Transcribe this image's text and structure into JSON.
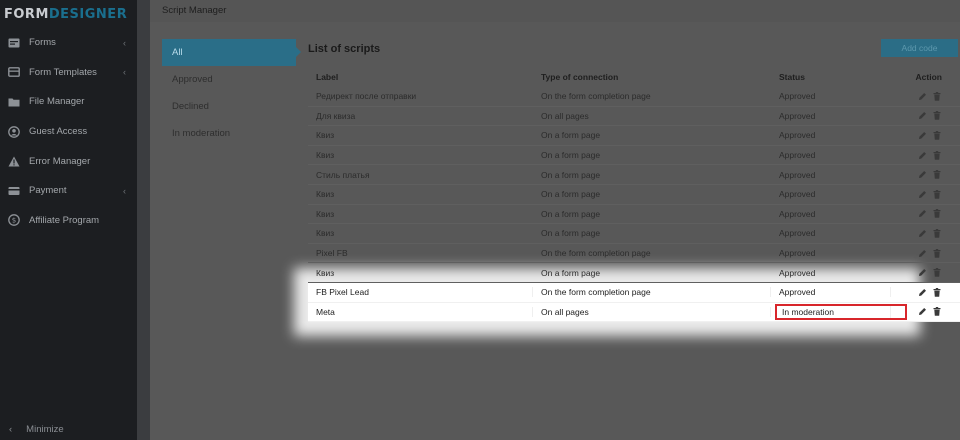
{
  "sidebar": {
    "logo_part1": "FORM",
    "logo_part2": "DESIGNER",
    "items": [
      {
        "label": "Forms",
        "icon": "forms-icon",
        "expandable": true
      },
      {
        "label": "Form Templates",
        "icon": "templates-icon",
        "expandable": true
      },
      {
        "label": "File Manager",
        "icon": "folder-icon",
        "expandable": false
      },
      {
        "label": "Guest Access",
        "icon": "user-circle-icon",
        "expandable": false
      },
      {
        "label": "Error Manager",
        "icon": "warning-icon",
        "expandable": false
      },
      {
        "label": "Payment",
        "icon": "card-icon",
        "expandable": true
      },
      {
        "label": "Affiliate Program",
        "icon": "dollar-icon",
        "expandable": false
      }
    ],
    "minimize_label": "Minimize"
  },
  "header": {
    "title": "Script Manager"
  },
  "filters": [
    {
      "label": "All",
      "active": true
    },
    {
      "label": "Approved",
      "active": false
    },
    {
      "label": "Declined",
      "active": false
    },
    {
      "label": "In moderation",
      "active": false
    }
  ],
  "list": {
    "title": "List of scripts",
    "add_button": "Add code",
    "columns": {
      "label": "Label",
      "type": "Type of connection",
      "status": "Status",
      "action": "Action"
    },
    "rows": [
      {
        "label": "Редирект после отправки",
        "type": "On the form completion page",
        "status": "Approved"
      },
      {
        "label": "Для квиза",
        "type": "On all pages",
        "status": "Approved"
      },
      {
        "label": "Квиз",
        "type": "On a form page",
        "status": "Approved"
      },
      {
        "label": "Квиз",
        "type": "On a form page",
        "status": "Approved"
      },
      {
        "label": "Стиль платья",
        "type": "On a form page",
        "status": "Approved"
      },
      {
        "label": "Квиз",
        "type": "On a form page",
        "status": "Approved"
      },
      {
        "label": "Квиз",
        "type": "On a form page",
        "status": "Approved"
      },
      {
        "label": "Квиз",
        "type": "On a form page",
        "status": "Approved"
      },
      {
        "label": "Pixel FB",
        "type": "On the form completion page",
        "status": "Approved"
      },
      {
        "label": "Квиз",
        "type": "On a form page",
        "status": "Approved"
      },
      {
        "label": "FB Pixel Lead",
        "type": "On the form completion page",
        "status": "Approved"
      },
      {
        "label": "Meta",
        "type": "On all pages",
        "status": "In moderation"
      }
    ]
  },
  "colors": {
    "accent": "#2a6e88",
    "highlight_outline": "#d8262b"
  }
}
